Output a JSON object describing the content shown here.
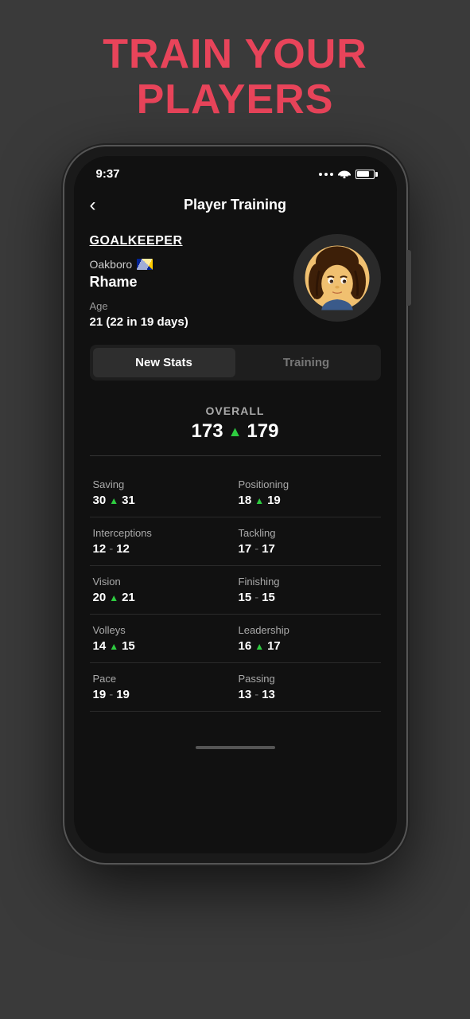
{
  "header": {
    "title": "TRAIN YOUR\nPLAYERS"
  },
  "statusBar": {
    "time": "9:37",
    "signal": "...",
    "wifi": "wifi",
    "battery": "battery"
  },
  "nav": {
    "back": "‹",
    "title": "Player Training"
  },
  "player": {
    "position": "GOALKEEPER",
    "club": "Oakboro",
    "name": "Rhame",
    "age_label": "Age",
    "age_value": "21 (22 in 19 days)"
  },
  "tabs": [
    {
      "label": "New Stats",
      "active": true
    },
    {
      "label": "Training",
      "active": false
    }
  ],
  "overall": {
    "label": "OVERALL",
    "old_value": "173",
    "new_value": "179"
  },
  "stats": [
    {
      "label": "Saving",
      "old": "30",
      "new": "31",
      "changed": true,
      "col": 0
    },
    {
      "label": "Positioning",
      "old": "18",
      "new": "19",
      "changed": true,
      "col": 1
    },
    {
      "label": "Interceptions",
      "old": "12",
      "new": "12",
      "changed": false,
      "col": 0
    },
    {
      "label": "Tackling",
      "old": "17",
      "new": "17",
      "changed": false,
      "col": 1
    },
    {
      "label": "Vision",
      "old": "20",
      "new": "21",
      "changed": true,
      "col": 0
    },
    {
      "label": "Finishing",
      "old": "15",
      "new": "15",
      "changed": false,
      "col": 1
    },
    {
      "label": "Volleys",
      "old": "14",
      "new": "15",
      "changed": true,
      "col": 0
    },
    {
      "label": "Leadership",
      "old": "16",
      "new": "17",
      "changed": true,
      "col": 1
    },
    {
      "label": "Pace",
      "old": "19",
      "new": "19",
      "changed": false,
      "col": 0
    },
    {
      "label": "Passing",
      "old": "13",
      "new": "13",
      "changed": false,
      "col": 1
    }
  ]
}
